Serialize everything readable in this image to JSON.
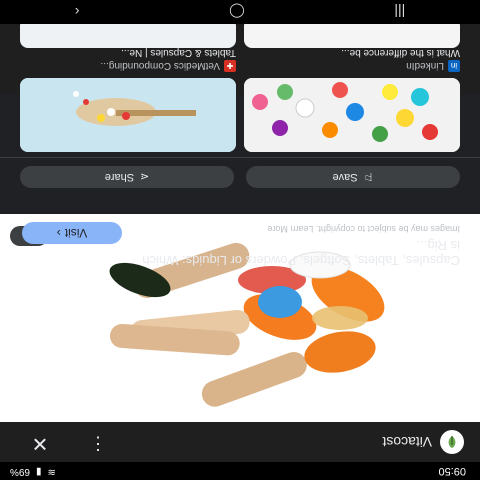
{
  "status": {
    "time": "09:50",
    "battery": "69%",
    "signal_icon": "signal-icon",
    "wifi_icon": "wifi-icon"
  },
  "topbar": {
    "site": "Vitacost"
  },
  "hero": {
    "alt": "pills-photo"
  },
  "info": {
    "title": "Capsules, Tablets, Softgels, Powders or Liquids: Which is Rig...",
    "copyright": "Images may be subject to copyright. Learn More",
    "visit_label": "Visit"
  },
  "actions": {
    "share_label": "Share",
    "save_label": "Save"
  },
  "related": [
    {
      "source": "LinkedIn",
      "title": "What is the difference be...",
      "badge_color": "#0a66c2"
    },
    {
      "source": "VetMedics Compounding...",
      "title": "Tablets & Capsules | Ne...",
      "badge_color": "#d93025"
    }
  ],
  "colors": {
    "bg": "#1f1f1f",
    "accent": "#8ab4f8"
  }
}
